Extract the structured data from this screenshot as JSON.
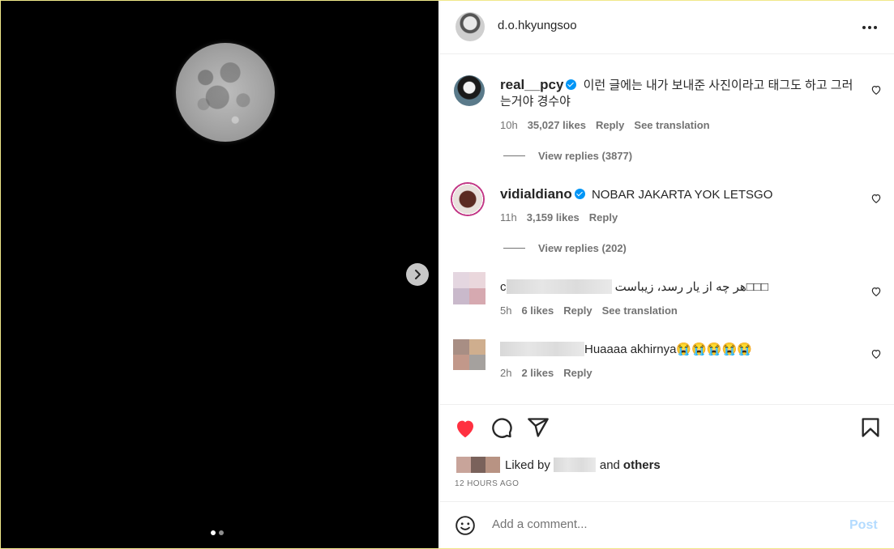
{
  "post": {
    "username": "d.o.hkyungsoo",
    "image_count": 2,
    "active_image": 1,
    "likes_text": "Liked by",
    "likes_and": "and",
    "likes_others": "others",
    "time_ago": "12 HOURS AGO",
    "liked": true
  },
  "comments": [
    {
      "username": "real__pcy",
      "verified": true,
      "text": "이런 글에는 내가 보내준 사진이라고 태그도 하고 그러는거야 경수야",
      "time": "10h",
      "likes": "35,027 likes",
      "reply": "Reply",
      "translation": "See translation",
      "view_replies": "View replies (3877)"
    },
    {
      "username": "vidialdiano",
      "verified": true,
      "text": "NOBAR JAKARTA YOK LETSGO",
      "time": "11h",
      "likes": "3,159 likes",
      "reply": "Reply",
      "view_replies": "View replies (202)"
    },
    {
      "username_prefix": "c",
      "text": "هر چه از یار رسد، زیباست□□□",
      "time": "5h",
      "likes": "6 likes",
      "reply": "Reply",
      "translation": "See translation"
    },
    {
      "text": "Huaaaa akhirnya😭😭😭😭😭",
      "time": "2h",
      "likes": "2 likes",
      "reply": "Reply"
    }
  ],
  "add_comment": {
    "placeholder": "Add a comment...",
    "post_label": "Post"
  },
  "icons": {
    "more": "more-horizontal-icon",
    "heart": "heart-icon",
    "comment": "comment-icon",
    "share": "share-icon",
    "save": "bookmark-icon",
    "emoji": "emoji-icon",
    "next": "chevron-right-icon"
  },
  "colors": {
    "liked_heart": "#ff3040",
    "verified": "#0095f6",
    "post_disabled": "#b3dbff"
  }
}
